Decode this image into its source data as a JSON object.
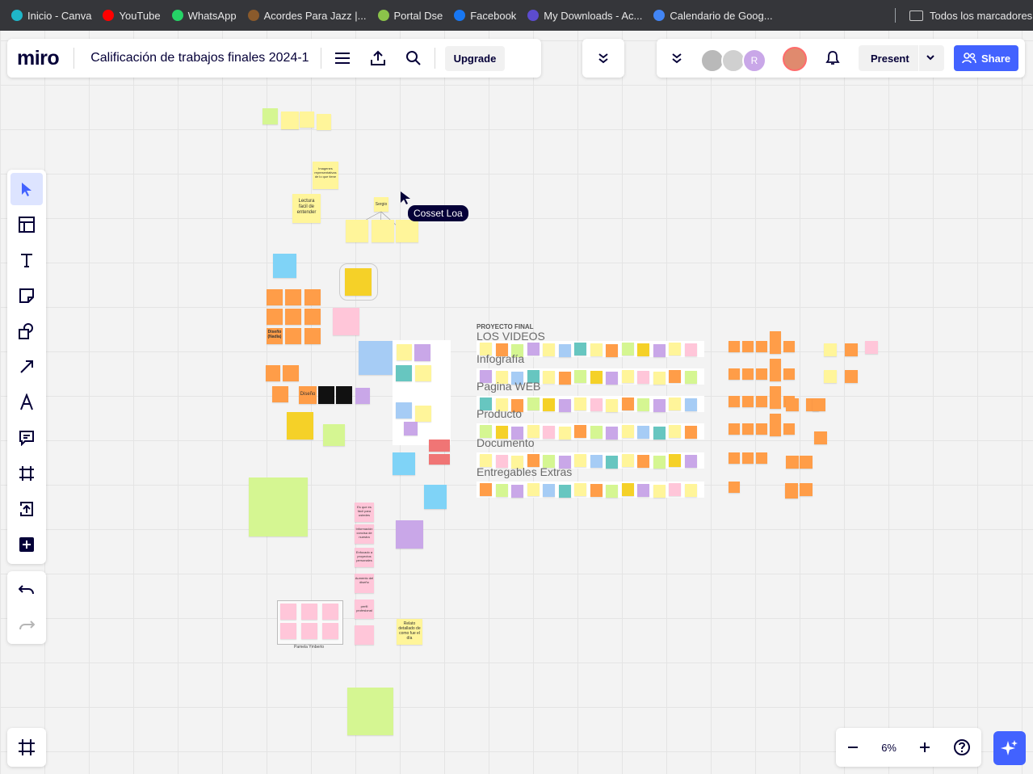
{
  "bookmarks": [
    {
      "label": "Inicio - Canva",
      "icon": "canva-icon",
      "color": "#1fb6c9"
    },
    {
      "label": "YouTube",
      "icon": "youtube-icon",
      "color": "#ff0000"
    },
    {
      "label": "WhatsApp",
      "icon": "whatsapp-icon",
      "color": "#25d366"
    },
    {
      "label": "Acordes Para Jazz |...",
      "icon": "guitar-icon",
      "color": "#8a5a2b"
    },
    {
      "label": "Portal Dse",
      "icon": "portal-icon",
      "color": "#8bc34a"
    },
    {
      "label": "Facebook",
      "icon": "facebook-icon",
      "color": "#1877f2"
    },
    {
      "label": "My Downloads - Ac...",
      "icon": "downloads-icon",
      "color": "#5c4ccf"
    },
    {
      "label": "Calendario de Goog...",
      "icon": "calendar-icon",
      "color": "#4285f4"
    }
  ],
  "bookmarks_all": "Todos los marcadores",
  "header": {
    "logo": "miro",
    "board_title": "Calificación de trabajos finales 2024-1",
    "upgrade": "Upgrade",
    "present": "Present",
    "share": "Share",
    "avatar_initial": "R"
  },
  "cursor_label": "Cosset Loa",
  "board": {
    "section_title": "PROYECTO FINAL",
    "rows": [
      "LOS VIDEOS",
      "Infografía",
      "Pagina WEB",
      "Producto",
      "Documento",
      "Entregables Extras"
    ],
    "notes": {
      "lectura": "Lectura facil de entender",
      "imagenes": "Imagenes representativas de lo que tiene",
      "sergio": "Sergio",
      "diseno1": "Diseño (Nadia)",
      "diseno2": "Diseño",
      "pink1": "Es que es fácil para ustedes",
      "pink2": "Información concisa de nuestra",
      "pink3": "Enfocado a proyectos personales",
      "pink4": "Aumento del diseño",
      "pink5": "perfil profesional",
      "relato": "Relato detallado de como fue el día",
      "pamela": "Pamela Ymberto"
    }
  },
  "zoom": {
    "level": "6%"
  }
}
